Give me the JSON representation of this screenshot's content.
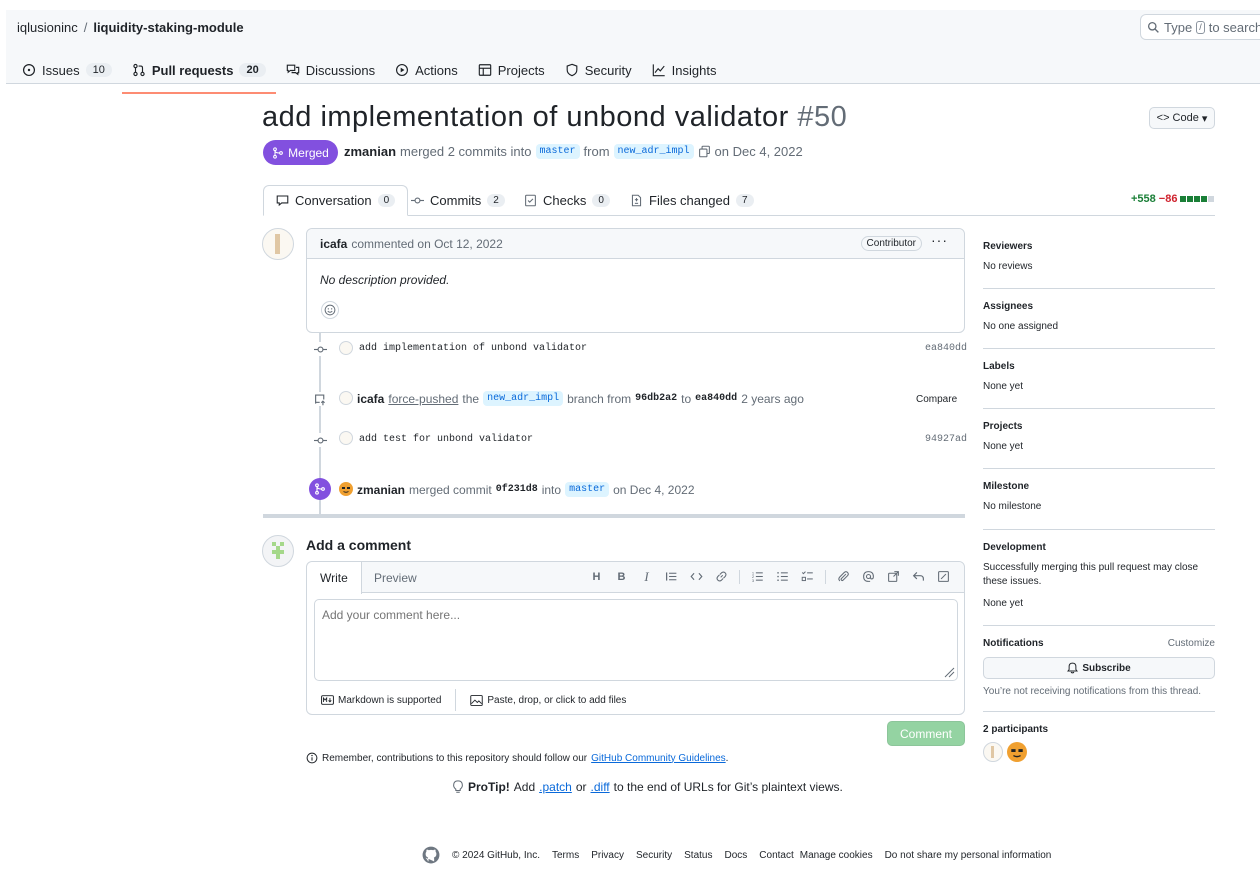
{
  "header": {
    "owner": "iqlusioninc",
    "separator": "/",
    "repo": "liquidity-staking-module",
    "search_prefix": "Type",
    "search_key": "/",
    "search_suffix": "to search"
  },
  "repo_nav": [
    {
      "label": "Issues",
      "count": "10",
      "icon": "issue-icon"
    },
    {
      "label": "Pull requests",
      "count": "20",
      "icon": "pull-request-icon",
      "active": true
    },
    {
      "label": "Discussions",
      "icon": "discussion-icon"
    },
    {
      "label": "Actions",
      "icon": "play-icon"
    },
    {
      "label": "Projects",
      "icon": "table-icon"
    },
    {
      "label": "Security",
      "icon": "shield-icon"
    },
    {
      "label": "Insights",
      "icon": "graph-icon"
    }
  ],
  "pr": {
    "title": "add implementation of unbond validator",
    "number": "#50",
    "code_button": "Code",
    "state": "Merged",
    "author": "zmanian",
    "merged_text": "merged 2 commits into",
    "base_branch": "master",
    "from_text": "from",
    "head_branch": "new_adr_impl",
    "date_text": "on Dec 4, 2022"
  },
  "tabs": [
    {
      "label": "Conversation",
      "count": "0"
    },
    {
      "label": "Commits",
      "count": "2"
    },
    {
      "label": "Checks",
      "count": "0"
    },
    {
      "label": "Files changed",
      "count": "7"
    }
  ],
  "diffstat": {
    "additions": "+558",
    "deletions": "−86"
  },
  "comment": {
    "author": "icafa",
    "action": "commented on Oct 12, 2022",
    "badge": "Contributor",
    "menu": "···",
    "body": "No description provided."
  },
  "timeline": {
    "commit1": {
      "message": "add implementation of unbond validator",
      "sha": "ea840dd"
    },
    "force_push": {
      "author": "icafa",
      "action": "force-pushed",
      "the": "the",
      "branch": "new_adr_impl",
      "branch_from": "branch from",
      "from_sha": "96db2a2",
      "to": "to",
      "to_sha": "ea840dd",
      "time": "2 years ago",
      "compare": "Compare"
    },
    "commit2": {
      "message": "add test for unbond validator",
      "sha": "94927ad"
    },
    "merge": {
      "author": "zmanian",
      "action": "merged commit",
      "sha": "0f231d8",
      "into": "into",
      "branch": "master",
      "date": "on Dec 4, 2022"
    }
  },
  "add_comment": {
    "title": "Add a comment",
    "write_tab": "Write",
    "preview_tab": "Preview",
    "placeholder": "Add your comment here...",
    "markdown_note": "Markdown is supported",
    "attach_note": "Paste, drop, or click to add files",
    "button": "Comment",
    "guidelines_prefix": "Remember, contributions to this repository should follow our",
    "guidelines_link": "GitHub Community Guidelines",
    "guidelines_suffix": "."
  },
  "protip": {
    "label": "ProTip!",
    "add": "Add",
    "patch": ".patch",
    "or": "or",
    "diff": ".diff",
    "rest": "to the end of URLs for Git’s plaintext views."
  },
  "sidebar": {
    "reviewers": {
      "title": "Reviewers",
      "value": "No reviews"
    },
    "assignees": {
      "title": "Assignees",
      "value": "No one assigned"
    },
    "labels": {
      "title": "Labels",
      "value": "None yet"
    },
    "projects": {
      "title": "Projects",
      "value": "None yet"
    },
    "milestone": {
      "title": "Milestone",
      "value": "No milestone"
    },
    "development": {
      "title": "Development",
      "desc": "Successfully merging this pull request may close these issues.",
      "value": "None yet"
    },
    "notifications": {
      "title": "Notifications",
      "customize": "Customize",
      "button": "Subscribe",
      "note": "You’re not receiving notifications from this thread."
    },
    "participants": {
      "title": "2 participants"
    }
  },
  "footer": {
    "copyright": "© 2024 GitHub, Inc.",
    "links": [
      "Terms",
      "Privacy",
      "Security",
      "Status",
      "Docs",
      "Contact",
      "Manage cookies",
      "Do not share my personal information"
    ]
  },
  "colors": {
    "merged": "#8250df",
    "accent": "#0969da",
    "additions": "#1a7f37",
    "deletions": "#cf222e",
    "comment_button": "#94d3a2"
  }
}
